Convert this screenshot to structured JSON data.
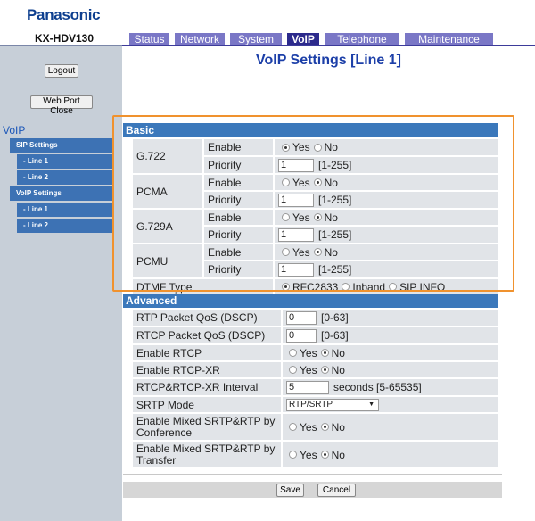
{
  "brand": {
    "logo": "Panasonic",
    "model": "KX-HDV130"
  },
  "nav": {
    "tabs": [
      {
        "label": "Status",
        "active": false
      },
      {
        "label": "Network",
        "active": false
      },
      {
        "label": "System",
        "active": false
      },
      {
        "label": "VoIP",
        "active": true
      },
      {
        "label": "Telephone",
        "active": false
      },
      {
        "label": "Maintenance",
        "active": false
      }
    ]
  },
  "sidebar": {
    "logout_label": "Logout",
    "web_port_close_label": "Web Port Close",
    "section_title": "VoIP",
    "items": [
      {
        "label": "SIP Settings"
      },
      {
        "label": "- Line 1"
      },
      {
        "label": "- Line 2"
      },
      {
        "label": "VoIP Settings"
      },
      {
        "label": "- Line 1"
      },
      {
        "label": "- Line 2"
      }
    ]
  },
  "page": {
    "title": "VoIP Settings [Line 1]"
  },
  "basic": {
    "title": "Basic",
    "enable_label": "Enable",
    "priority_label": "Priority",
    "yes_label": "Yes",
    "no_label": "No",
    "range_label": "[1-255]",
    "codecs": [
      {
        "name": "G.722",
        "enable": "Yes",
        "priority": "1"
      },
      {
        "name": "PCMA",
        "enable": "No",
        "priority": "1"
      },
      {
        "name": "G.729A",
        "enable": "No",
        "priority": "1"
      },
      {
        "name": "PCMU",
        "enable": "No",
        "priority": "1"
      }
    ],
    "dtmf": {
      "label": "DTMF Type",
      "options": [
        "RFC2833",
        "Inband",
        "SIP INFO"
      ],
      "selected": "RFC2833"
    }
  },
  "advanced": {
    "title": "Advanced",
    "rtp_qos": {
      "label": "RTP Packet QoS (DSCP)",
      "value": "0",
      "range": "[0-63]"
    },
    "rtcp_qos": {
      "label": "RTCP Packet QoS (DSCP)",
      "value": "0",
      "range": "[0-63]"
    },
    "enable_rtcp": {
      "label": "Enable RTCP",
      "selected": "No"
    },
    "enable_rtcp_xr": {
      "label": "Enable RTCP-XR",
      "selected": "No"
    },
    "interval": {
      "label": "RTCP&RTCP-XR Interval",
      "value": "5",
      "range": "seconds [5-65535]"
    },
    "srtp_mode": {
      "label": "SRTP Mode",
      "value": "RTP/SRTP"
    },
    "mixed_conf": {
      "label": "Enable Mixed SRTP&RTP by Conference",
      "selected": "No"
    },
    "mixed_transfer": {
      "label": "Enable Mixed SRTP&RTP by Transfer",
      "selected": "No"
    }
  },
  "actions": {
    "save_label": "Save",
    "cancel_label": "Cancel"
  },
  "colors": {
    "highlight": "#f0922e",
    "section_header": "#3b78bb",
    "tab": "#7a77c6",
    "tab_active": "#2c2a8c"
  }
}
